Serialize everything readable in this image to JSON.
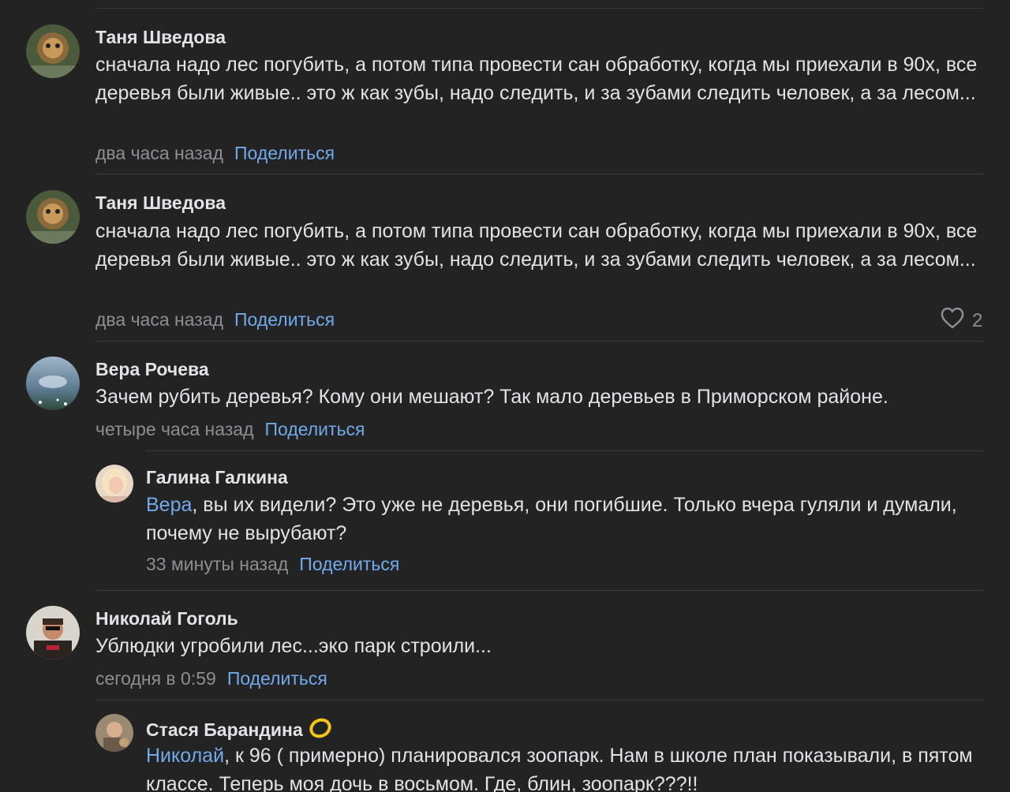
{
  "comments": [
    {
      "author": "Таня Шведова",
      "text": "сначала надо лес погубить, а потом типа провести сан обработку, когда мы приехали в 90х, все деревья были живые.. это ж как зубы, надо следить, и за зубами следить человек, а за лесом...",
      "time": "два часа назад",
      "share": "Поделиться"
    },
    {
      "author": "Таня Шведова",
      "text": "сначала надо лес погубить, а потом типа провести сан обработку, когда мы приехали в 90х, все деревья были живые.. это ж как зубы, надо следить, и за зубами следить человек, а за лесом...",
      "time": "два часа назад",
      "share": "Поделиться",
      "likes": "2"
    },
    {
      "author": "Вера Рочева",
      "text": "Зачем рубить деревья? Кому они мешают? Так мало деревьев в Приморском районе.",
      "time": "четыре часа назад",
      "share": "Поделиться"
    },
    {
      "author": "Галина Галкина",
      "mention": "Вера",
      "text": ", вы их видели? Это уже не деревья, они погибшие. Только вчера гуляли и думали, почему не вырубают?",
      "time": "33 минуты назад",
      "share": "Поделиться"
    },
    {
      "author": "Николай Гоголь",
      "text": "Ублюдки угробили лес...эко парк строили...",
      "time": "сегодня в 0:59",
      "share": "Поделиться"
    },
    {
      "author": "Стася Барандина",
      "mention": "Николай",
      "text": ", к 96 ( примерно) планировался зоопарк. Нам в школе план показывали, в пятом классе. Теперь моя дочь в восьмом. Где, блин, зоопарк???!!"
    }
  ],
  "icons": {
    "like": "heart-outline-icon",
    "badge": "ring-icon"
  },
  "colors": {
    "background": "#232324",
    "text": "#e1e3e6",
    "secondary": "#8b8e93",
    "link": "#71aaeb",
    "divider": "#3a3a3c",
    "badge": "#f5c518"
  }
}
